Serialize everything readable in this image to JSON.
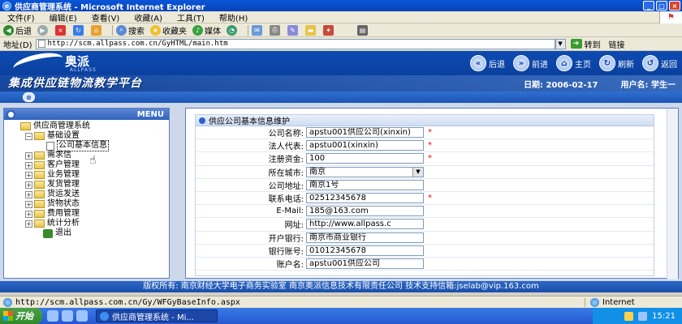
{
  "window": {
    "title": "供应商管理系统 - Microsoft Internet Explorer",
    "min": "_",
    "max": "□",
    "close": "×"
  },
  "menubar": {
    "items": [
      "文件(F)",
      "编辑(E)",
      "查看(V)",
      "收藏(A)",
      "工具(T)",
      "帮助(H)"
    ]
  },
  "toolbar": {
    "back": "后退",
    "search": "搜索",
    "favorites": "收藏夹",
    "media": "媒体"
  },
  "address": {
    "label": "地址(D)",
    "url": "http://scm.allpass.com.cn/GyHTML/main.htm",
    "go": "转到",
    "links": "链接"
  },
  "header": {
    "logo_text": "奥派",
    "logo_sub": "ALLPASS",
    "slogan": "集成供应链物流教学平台",
    "nav": [
      "后退",
      "前进",
      "主页",
      "刷新",
      "返回"
    ],
    "date_label": "日期: 2006-02-17",
    "user_label": "用户名: 学生一"
  },
  "tree": {
    "menu_title": "MENU",
    "root": "供应商管理系统",
    "basic": "基础设置",
    "company_info": "公司基本信息",
    "items": [
      "需求信",
      "客户管理",
      "业务管理",
      "发货管理",
      "货运发送",
      "货物状态",
      "费用管理",
      "统计分析"
    ],
    "exit": "退出"
  },
  "form": {
    "title": "供应公司基本信息维护",
    "rows": [
      {
        "label": "公司名称:",
        "value": "apstu001供应公司(xinxin)",
        "required": "*"
      },
      {
        "label": "法人代表:",
        "value": "apstu001(xinxin)",
        "required": "*"
      },
      {
        "label": "注册资金:",
        "value": "100",
        "required": "*"
      },
      {
        "label": "所在城市:",
        "value": "南京",
        "required": ""
      },
      {
        "label": "公司地址:",
        "value": "南京1号",
        "required": ""
      },
      {
        "label": "联系电话:",
        "value": "02512345678",
        "required": "*"
      },
      {
        "label": "E-Mail:",
        "value": "185@163.com",
        "required": ""
      },
      {
        "label": "网址:",
        "value": "http://www.allpass.c",
        "required": ""
      },
      {
        "label": "开户银行:",
        "value": "南京市商业银行",
        "required": ""
      },
      {
        "label": "银行账号:",
        "value": "01012345678",
        "required": ""
      },
      {
        "label": "账户名:",
        "value": "apstu001供应公司",
        "required": ""
      }
    ]
  },
  "footer": {
    "text": "版权所有: 南京财经大学电子商务实验室 南京奥派信息技术有限责任公司 技术支持信箱:jselab@vip.163.com"
  },
  "status": {
    "url": "http://scm.allpass.com.cn/Gy/WFGyBaseInfo.aspx",
    "zone": "Internet"
  },
  "taskbar": {
    "start": "开始",
    "task": "供应商管理系统 - Mi...",
    "time": "15:21"
  }
}
